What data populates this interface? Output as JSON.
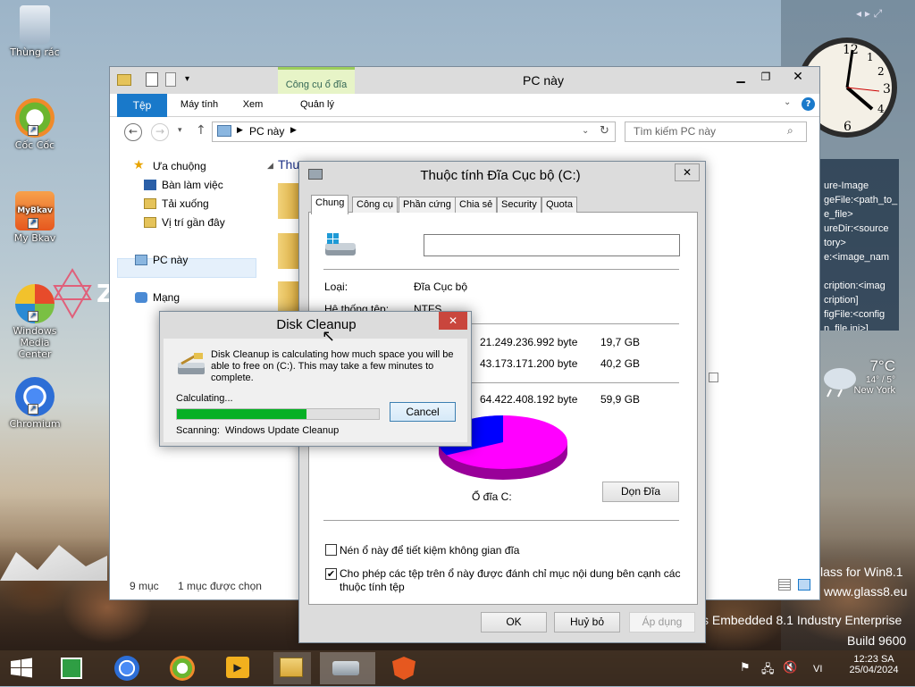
{
  "desktop": {
    "icons": [
      {
        "label": "Thùng rác"
      },
      {
        "label": "Cốc Cốc"
      },
      {
        "label": "My Bkav"
      },
      {
        "label": "Windows Media Center"
      },
      {
        "label": "Chromium"
      }
    ],
    "edition_text": "s Embedded 8.1 Industry Enterprise",
    "build_text": "Build 9600",
    "glass_text": "lass for Win8.1",
    "glass_url": "www.glass8.eu",
    "notes_lines": [
      "ure-Image",
      "geFile:<path_to_",
      "e_file>",
      "ureDir:<source",
      "tory>",
      "e:<image_nam",
      "",
      "cription:<imag",
      "cription]",
      "figFile:<config",
      "n_file.ini>]"
    ]
  },
  "weather": {
    "temp": "7°C",
    "range": "14° / 5°",
    "city": "New York"
  },
  "explorer": {
    "title": "PC này",
    "context_tab": "Công cụ ổ đĩa",
    "ribbon_tabs": [
      "Tệp",
      "Máy tính",
      "Xem",
      "Quản lý"
    ],
    "address": "PC này",
    "search_placeholder": "Tìm kiếm PC này",
    "nav": {
      "favorites": "Ưa chuộng",
      "items": [
        "Bàn làm việc",
        "Tải xuống",
        "Vị trí gần đây"
      ],
      "pc": "PC này",
      "network": "Mạng"
    },
    "group_header": "Thư",
    "status": {
      "count": "9 mục",
      "selected": "1 mục được chọn"
    }
  },
  "props": {
    "title": "Thuộc tính Đĩa Cục bộ (C:)",
    "tabs": [
      "Chung",
      "Công cụ",
      "Phần cứng",
      "Chia sẻ",
      "Security",
      "Quota"
    ],
    "name_value": "",
    "type_label": "Loại:",
    "type_value": "Đĩa Cục bộ",
    "fs_label": "Hệ thống tệp:",
    "fs_value": "NTFS",
    "used_bytes": "21.249.236.992 byte",
    "used_gb": "19,7 GB",
    "free_bytes": "43.173.171.200 byte",
    "free_gb": "40,2 GB",
    "cap_bytes": "64.422.408.192 byte",
    "cap_gb": "59,9 GB",
    "drive_label": "Ổ đĩa C:",
    "cleanup_btn": "Dọn Đĩa",
    "compress_label": "Nén ổ này để tiết kiệm không gian đĩa",
    "index_label": "Cho phép các tệp trên ổ này được đánh chỉ mục nội dung bên cạnh các thuộc tính tệp",
    "ok": "OK",
    "cancel": "Huỷ bỏ",
    "apply": "Áp dụng",
    "used_fraction": 0.33,
    "colors": {
      "used": "#0000ff",
      "free": "#ff00ff"
    }
  },
  "cleanup": {
    "title": "Disk Cleanup",
    "message": "Disk Cleanup is calculating how much space you will be able to free on  (C:). This may take a few minutes to complete.",
    "calc_label": "Calculating...",
    "cancel": "Cancel",
    "scanning_label": "Scanning:",
    "scanning_value": "Windows Update Cleanup",
    "progress": 0.64
  },
  "taskbar": {
    "lang": "VI",
    "time": "12:23 SA",
    "date": "25/04/2024"
  }
}
